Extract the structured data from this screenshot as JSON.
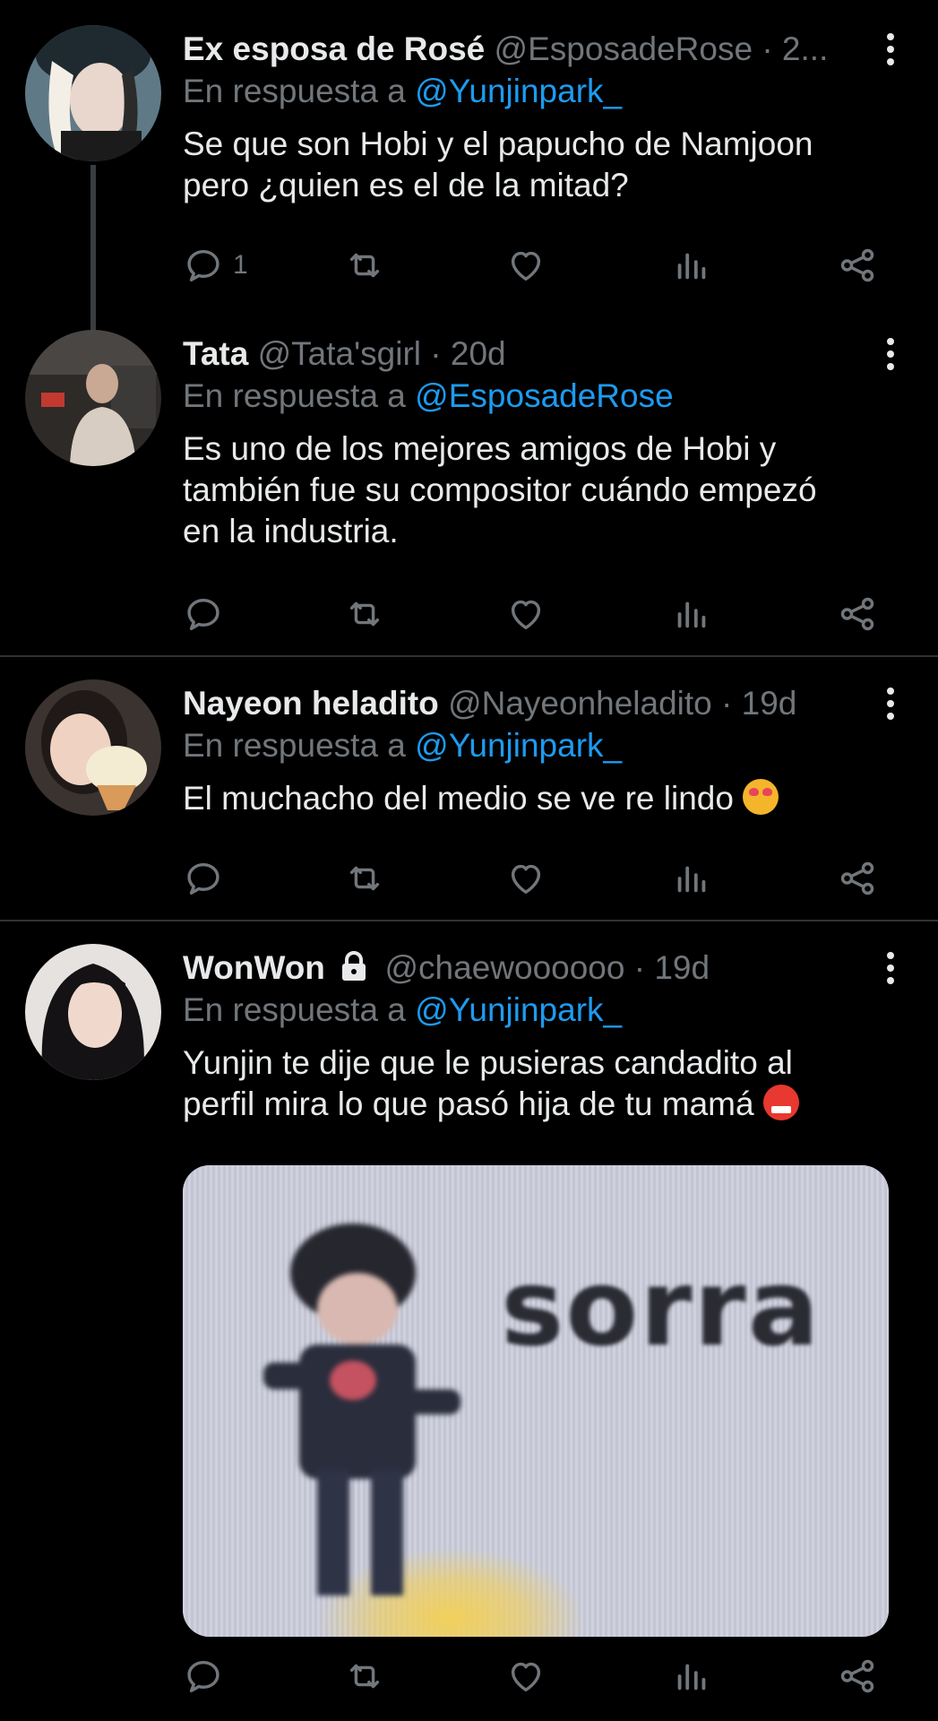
{
  "tweets": [
    {
      "name": "Ex esposa de Rosé",
      "handle": "@EsposadeRose · 2...",
      "reply_prefix": "En respuesta a",
      "reply_to": "@Yunjinpark_",
      "text": "Se que son Hobi y el papucho de Namjoon\npero ¿quien es el de la mitad?",
      "reply_count": "1"
    },
    {
      "name": "Tata",
      "handle": "@Tata'sgirl · 20d",
      "reply_prefix": "En respuesta a",
      "reply_to": "@EsposadeRose",
      "text": "Es uno de los mejores amigos de Hobi y\ntambién fue su compositor cuándo empezó\nen la industria.",
      "reply_count": ""
    },
    {
      "name": "Nayeon heladito",
      "handle": "@Nayeonheladito · 19d",
      "reply_prefix": "En respuesta a",
      "reply_to": "@Yunjinpark_",
      "text": "El muchacho del medio se ve re lindo",
      "reply_count": ""
    },
    {
      "name": "WonWon",
      "handle": "@chaewoooooo · 19d",
      "reply_prefix": "En respuesta a",
      "reply_to": "@Yunjinpark_",
      "text": "Yunjin te dije que le pusieras candadito al\nperfil mira lo que pasó hija de tu mamá",
      "reply_count": "",
      "media_caption": "sorra"
    }
  ],
  "colors": {
    "background": "#000000",
    "text": "#e7e9ea",
    "muted": "#71767b",
    "link": "#1d9bf0",
    "divider": "#2f3336"
  },
  "icons": [
    "reply-icon",
    "retweet-icon",
    "like-icon",
    "views-icon",
    "share-icon",
    "more-icon",
    "lock-icon"
  ]
}
